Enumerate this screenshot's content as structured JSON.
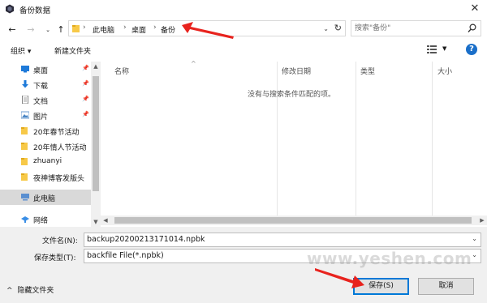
{
  "window": {
    "title": "备份数据"
  },
  "address_bar": {
    "breadcrumbs": [
      "此电脑",
      "桌面",
      "备份"
    ]
  },
  "search": {
    "placeholder": "搜索\"备份\""
  },
  "toolbar": {
    "organize_label": "组织 ▾",
    "new_folder_label": "新建文件夹"
  },
  "sidebar": {
    "items": [
      {
        "label": "桌面",
        "icon": "desktop-icon",
        "pinned": true
      },
      {
        "label": "下载",
        "icon": "download-icon",
        "pinned": true
      },
      {
        "label": "文档",
        "icon": "document-icon",
        "pinned": true
      },
      {
        "label": "图片",
        "icon": "picture-icon",
        "pinned": true
      },
      {
        "label": "20年春节活动",
        "icon": "folder-icon",
        "pinned": false
      },
      {
        "label": "20年情人节活动",
        "icon": "folder-icon",
        "pinned": false
      },
      {
        "label": "zhuanyi",
        "icon": "folder-icon",
        "pinned": false
      },
      {
        "label": "夜神博客发版头",
        "icon": "folder-icon",
        "pinned": false
      },
      {
        "label": "此电脑",
        "icon": "computer-icon",
        "pinned": false
      },
      {
        "label": "网络",
        "icon": "network-icon",
        "pinned": false
      }
    ]
  },
  "file_list": {
    "columns": [
      "名称",
      "修改日期",
      "类型",
      "大小"
    ],
    "empty_message": "没有与搜索条件匹配的项。"
  },
  "form": {
    "filename_label": "文件名(N):",
    "filename_value": "backup20200213171014.npbk",
    "filetype_label": "保存类型(T):",
    "filetype_value": "backfile File(*.npbk)"
  },
  "footer": {
    "hide_folders_label": "隐藏文件夹",
    "save_label": "保存(S)",
    "cancel_label": "取消"
  },
  "watermark": "www.yeshen.com",
  "colors": {
    "accent": "#0078d7",
    "annotation_red": "#e8231e",
    "help_blue": "#1a6fc9"
  }
}
